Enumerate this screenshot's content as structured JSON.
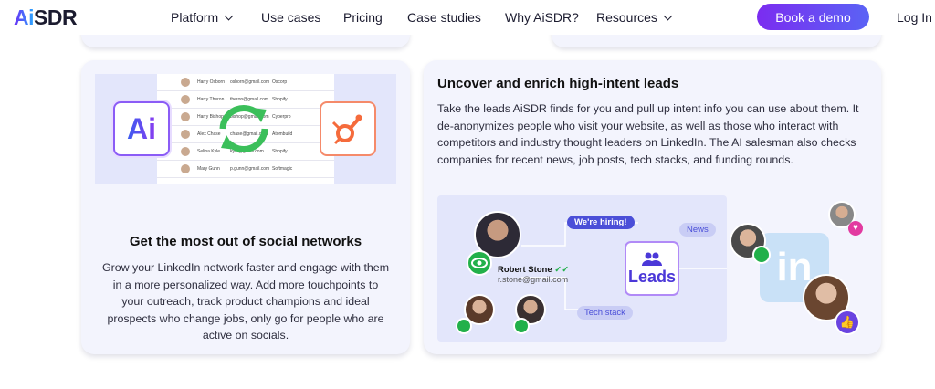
{
  "nav": {
    "logo_prefix": "Ai",
    "logo_suffix": "SDR",
    "items": [
      "Platform",
      "Use cases",
      "Pricing",
      "Case studies",
      "Why AiSDR?",
      "Resources"
    ],
    "demo_label": "Book a demo",
    "login_label": "Log In"
  },
  "card1": {
    "table_rows": [
      {
        "name": "Harry Osborn",
        "email": "osborn@gmail.com",
        "company": "Oscorp"
      },
      {
        "name": "Harry Theron",
        "email": "theron@gmail.com",
        "company": "Shopify"
      },
      {
        "name": "Harry Bishop",
        "email": "bishop@gmail.com",
        "company": "Cyberpro"
      },
      {
        "name": "Alex Chase",
        "email": "chase@gmail.com",
        "company": "Atombuild"
      },
      {
        "name": "Selina Kyle",
        "email": "kyle@gmail.com",
        "company": "Shopify"
      },
      {
        "name": "Mary Gunn",
        "email": "p.gunn@gmail.com",
        "company": "Softmagic"
      }
    ],
    "ai_label": "Ai",
    "title": "Get the most out of social networks",
    "text": "Grow your LinkedIn network faster and engage with them in a more personalized way. Add more touchpoints to your outreach, track product champions and ideal prospects who change jobs, only go for people who are active on socials."
  },
  "card2": {
    "title": "Uncover and enrich high-intent leads",
    "text": "Take the leads AiSDR finds for you and pull up intent info you can use about them. It de-anonymizes people who visit your website, as well as those who interact with competitors and industry thought leaders on LinkedIn. The AI salesman also checks companies for recent news, job posts, tech stacks, and funding rounds.",
    "hiring_label": "We're hiring!",
    "news_label": "News",
    "tech_label": "Tech stack",
    "leads_label": "Leads",
    "person_name": "Robert Stone",
    "person_email": "r.stone@gmail.com",
    "linkedin_label": "in"
  },
  "colors": {
    "accent": "#6a2cf5",
    "eye_green": "#22b04a",
    "card_bg": "#f3f4fd"
  }
}
